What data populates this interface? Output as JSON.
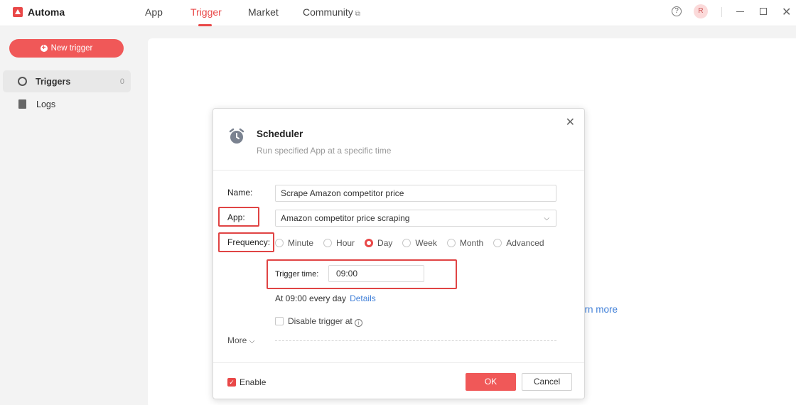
{
  "app": {
    "name": "Automa"
  },
  "nav": {
    "tabs": [
      {
        "label": "App"
      },
      {
        "label": "Trigger"
      },
      {
        "label": "Market"
      },
      {
        "label": "Community"
      }
    ],
    "active": "Trigger"
  },
  "header": {
    "avatar_initial": "R"
  },
  "sidebar": {
    "new_trigger_label": "New trigger",
    "items": [
      {
        "label": "Triggers",
        "count": "0"
      },
      {
        "label": "Logs"
      }
    ]
  },
  "background": {
    "learn_more_partial": "arn more"
  },
  "modal": {
    "title": "Scheduler",
    "subtitle": "Run specified App at a specific time",
    "name_label": "Name:",
    "name_value": "Scrape Amazon competitor price",
    "app_label": "App:",
    "app_value": "Amazon competitor price scraping",
    "frequency_label": "Frequency:",
    "frequency_options": [
      "Minute",
      "Hour",
      "Day",
      "Week",
      "Month",
      "Advanced"
    ],
    "frequency_selected": "Day",
    "trigger_time_label": "Trigger time:",
    "trigger_time_value": "09:00",
    "schedule_summary": "At 09:00 every day",
    "details_link": "Details",
    "disable_label": "Disable trigger at",
    "more_label": "More",
    "enable_label": "Enable",
    "enable_checked": true,
    "ok_label": "OK",
    "cancel_label": "Cancel"
  },
  "colors": {
    "accent": "#e94848",
    "link": "#3f7fd8",
    "highlight_box": "#e04444"
  }
}
